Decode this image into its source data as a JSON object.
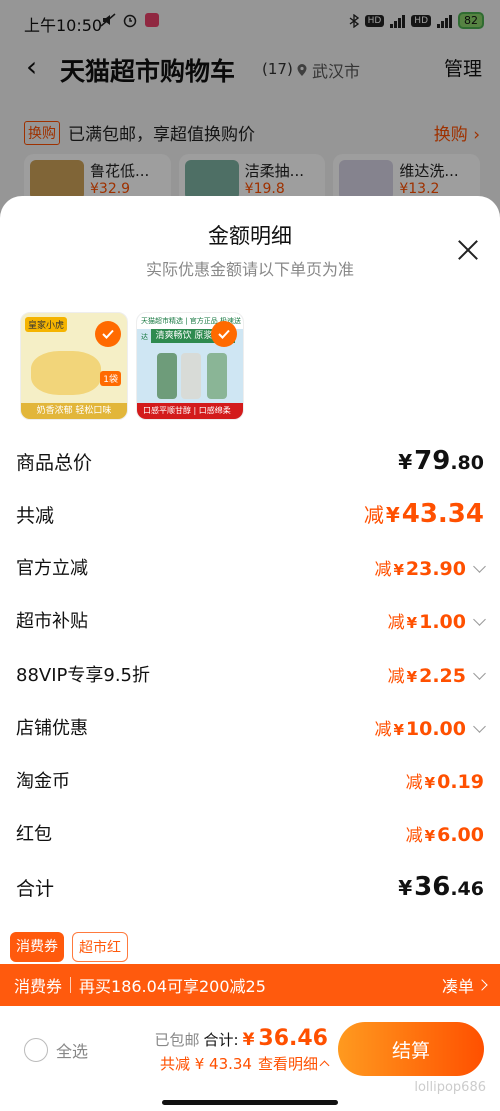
{
  "status_bar": {
    "time": "上午10:50",
    "battery": "82"
  },
  "header": {
    "title": "天猫超市购物车",
    "count": "(17)",
    "location": "武汉市",
    "manage": "管理"
  },
  "promo": {
    "tag": "换购",
    "text": "已满包邮，享超值换购价",
    "link": "换购 ›"
  },
  "swap_items": [
    {
      "name": "鲁花低...",
      "price": "¥32.9"
    },
    {
      "name": "洁柔抽...",
      "price": "¥19.8"
    },
    {
      "name": "维达洗...",
      "price": "¥13.2"
    }
  ],
  "sheet": {
    "title": "金额明细",
    "subtitle": "实际优惠金额请以下单页为准",
    "products": [
      {
        "brand": "皇家小虎",
        "badge": "1袋",
        "strip": "奶香浓郁 轻松口味"
      },
      {
        "top": "天猫超市精选 | 官方正品 极速送达",
        "banner": "清爽畅饮 原浆麦香",
        "strip": "口感平顺甘醇 | 口感绵柔"
      }
    ],
    "rows": [
      {
        "label": "商品总价",
        "prefix": "",
        "yen": "¥",
        "int": "79",
        "dec": ".80",
        "style": "total"
      },
      {
        "label": "共减",
        "prefix": "减",
        "yen": "¥",
        "int": "43.34",
        "dec": "",
        "style": "discount-total"
      },
      {
        "label": "官方立减",
        "prefix": "减",
        "yen": "¥",
        "int": "23.90",
        "dec": "",
        "style": "discount",
        "expandable": true
      },
      {
        "label": "超市补贴",
        "prefix": "减",
        "yen": "¥",
        "int": "1.00",
        "dec": "",
        "style": "discount",
        "expandable": true
      },
      {
        "label": "88VIP专享9.5折",
        "prefix": "减",
        "yen": "¥",
        "int": "2.25",
        "dec": "",
        "style": "discount",
        "expandable": true
      },
      {
        "label": "店铺优惠",
        "prefix": "减",
        "yen": "¥",
        "int": "10.00",
        "dec": "",
        "style": "discount",
        "expandable": true
      },
      {
        "label": "淘金币",
        "prefix": "减",
        "yen": "¥",
        "int": "0.19",
        "dec": "",
        "style": "discount"
      },
      {
        "label": "红包",
        "prefix": "减",
        "yen": "¥",
        "int": "6.00",
        "dec": "",
        "style": "discount"
      },
      {
        "label": "合计",
        "prefix": "",
        "yen": "¥",
        "int": "36",
        "dec": ".46",
        "style": "total"
      }
    ],
    "tabs": [
      "消费券",
      "超市红"
    ]
  },
  "coupon_banner": {
    "tag": "消费券",
    "text": "再买186.04可享200减25",
    "link": "凑单"
  },
  "bottom_bar": {
    "select_all": "全选",
    "free_shipping": "已包邮",
    "total_label": "合计:",
    "total_yen": "¥",
    "total_value": "36.46",
    "saved_text": "共减 ¥ 43.34",
    "detail_link": "查看明细",
    "checkout": "结算",
    "watermark": "lollipop686"
  },
  "colors": {
    "accent": "#ff5000",
    "banner": "#ff5a0d"
  }
}
